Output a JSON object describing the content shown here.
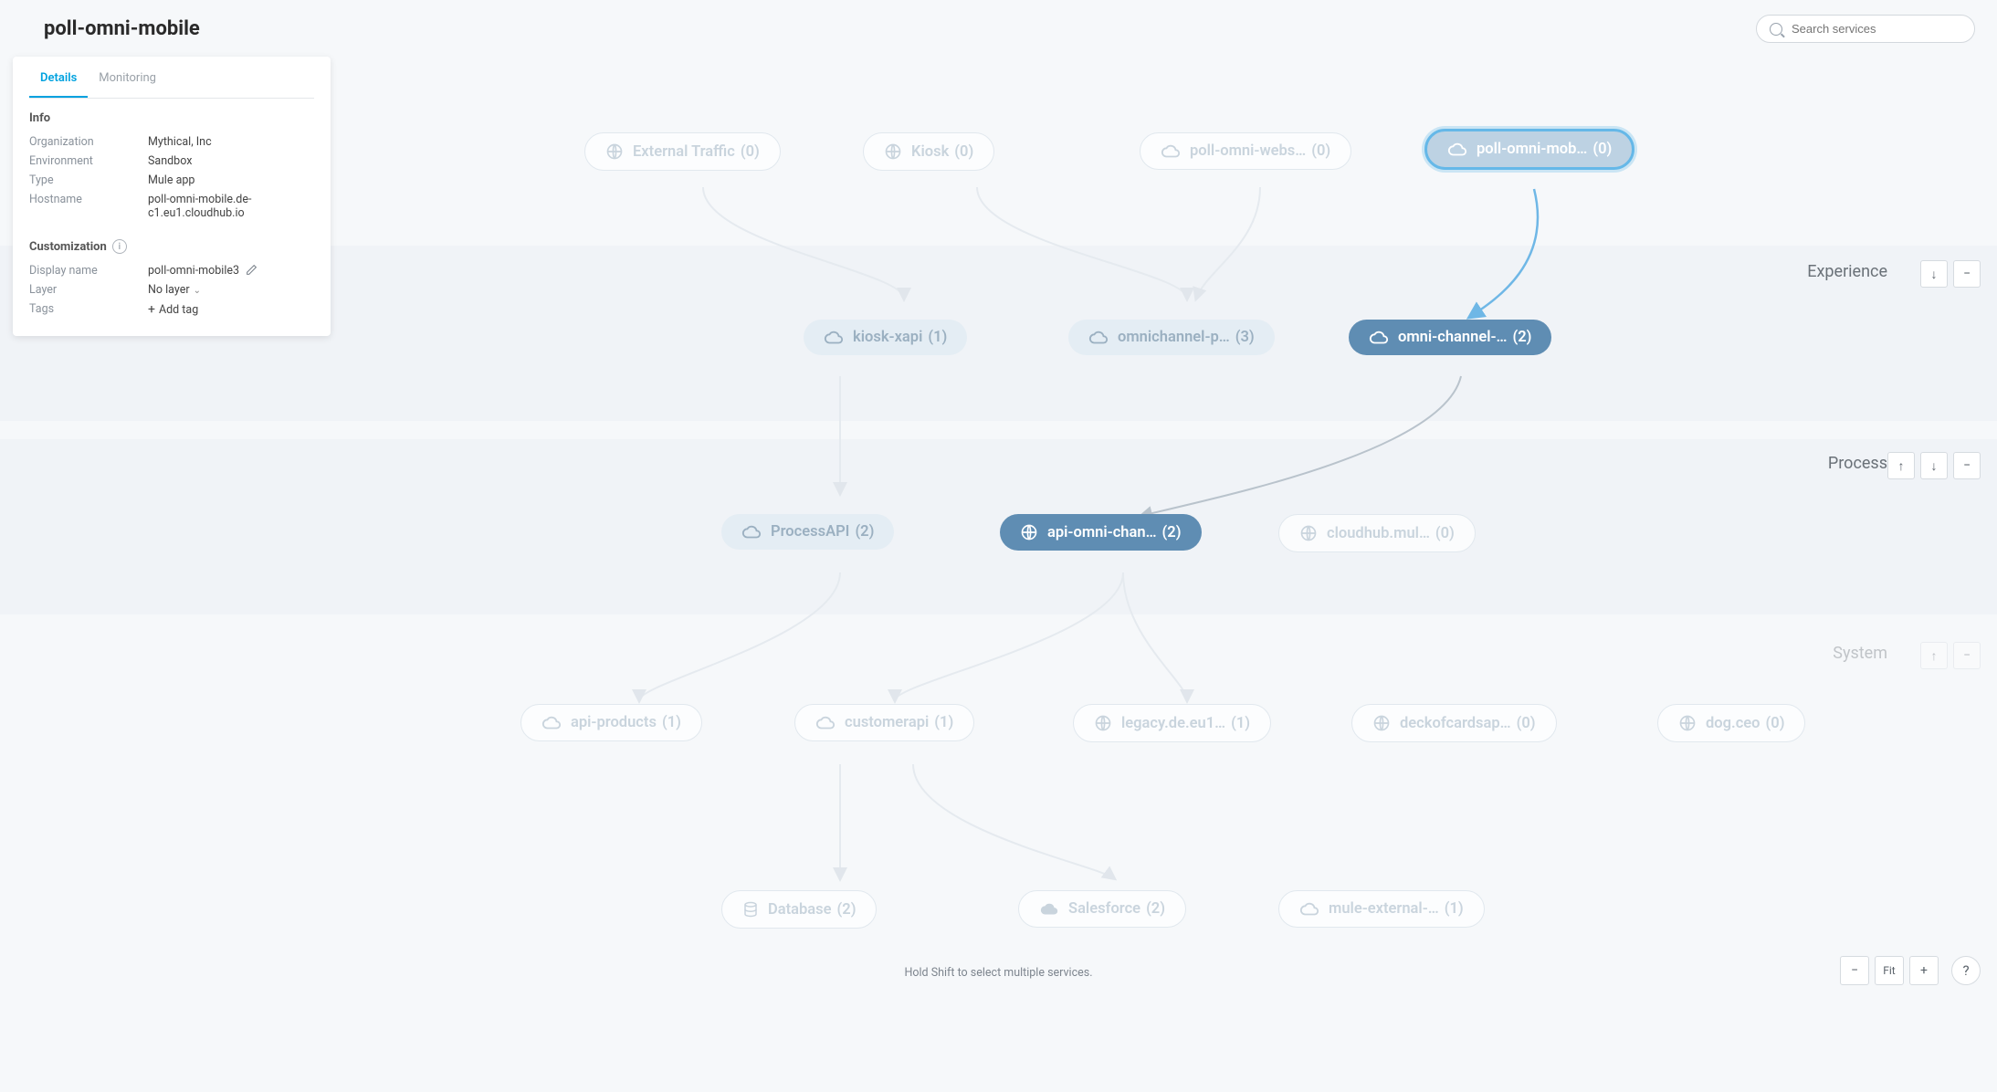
{
  "title": "poll-omni-mobile",
  "search": {
    "placeholder": "Search services"
  },
  "tabs": {
    "details": "Details",
    "monitoring": "Monitoring"
  },
  "info": {
    "heading": "Info",
    "organization_k": "Organization",
    "organization_v": "Mythical, Inc",
    "environment_k": "Environment",
    "environment_v": "Sandbox",
    "type_k": "Type",
    "type_v": "Mule app",
    "hostname_k": "Hostname",
    "hostname_v": "poll-omni-mobile.de-c1.eu1.cloudhub.io"
  },
  "custom": {
    "heading": "Customization",
    "displayname_k": "Display name",
    "displayname_v": "poll-omni-mobile3",
    "layer_k": "Layer",
    "layer_v": "No layer",
    "tags_k": "Tags",
    "tags_v": "Add tag"
  },
  "layers": {
    "top": "",
    "experience": "Experience",
    "process": "Process",
    "system": "System"
  },
  "nodes": {
    "n1": {
      "label": "External Traffic",
      "count": "(0)"
    },
    "n2": {
      "label": "Kiosk",
      "count": "(0)"
    },
    "n3": {
      "label": "poll-omni-webs…",
      "count": "(0)"
    },
    "n4": {
      "label": "poll-omni-mob…",
      "count": "(0)"
    },
    "n5": {
      "label": "kiosk-xapi",
      "count": "(1)"
    },
    "n6": {
      "label": "omnichannel-p…",
      "count": "(3)"
    },
    "n7": {
      "label": "omni-channel-…",
      "count": "(2)"
    },
    "n8": {
      "label": "ProcessAPI",
      "count": "(2)"
    },
    "n9": {
      "label": "api-omni-chan…",
      "count": "(2)"
    },
    "n10": {
      "label": "cloudhub.mul…",
      "count": "(0)"
    },
    "n11": {
      "label": "api-products",
      "count": "(1)"
    },
    "n12": {
      "label": "customerapi",
      "count": "(1)"
    },
    "n13": {
      "label": "legacy.de.eu1…",
      "count": "(1)"
    },
    "n14": {
      "label": "deckofcardsap…",
      "count": "(0)"
    },
    "n15": {
      "label": "dog.ceo",
      "count": "(0)"
    },
    "n16": {
      "label": "Database",
      "count": "(2)"
    },
    "n17": {
      "label": "Salesforce",
      "count": "(2)"
    },
    "n18": {
      "label": "mule-external-…",
      "count": "(1)"
    }
  },
  "hint": "Hold Shift to select multiple services.",
  "controls": {
    "fit": "Fit"
  }
}
